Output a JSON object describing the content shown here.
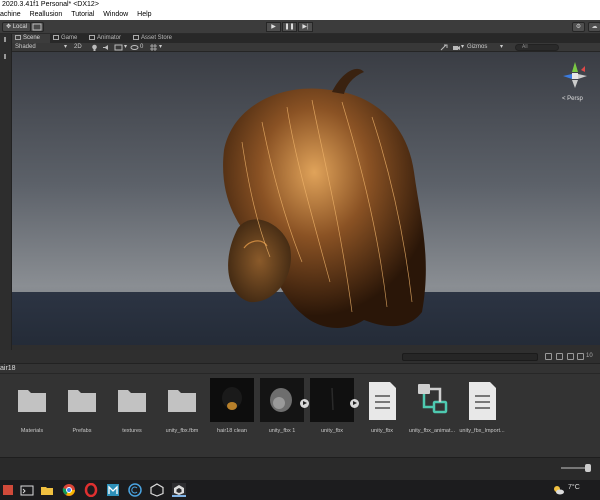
{
  "window": {
    "title": "2020.3.41f1 Personal* <DX12>"
  },
  "menu": {
    "items": [
      "achine",
      "Reallusion",
      "Tutorial",
      "Window",
      "Help"
    ]
  },
  "toolbar": {
    "pivot_label": "Local"
  },
  "tabs": [
    {
      "label": "Scene"
    },
    {
      "label": "Game"
    },
    {
      "label": "Animator"
    },
    {
      "label": "Asset Store"
    }
  ],
  "scene_toolbar": {
    "shading_mode": "Shaded",
    "view_2d": "2D",
    "gizmos_label": "Gizmos",
    "search_placeholder": "All"
  },
  "viewport": {
    "projection_label": "< Persp"
  },
  "project": {
    "breadcrumb": "air18",
    "item_count": "10",
    "assets": [
      {
        "name": "Materials",
        "type": "folder"
      },
      {
        "name": "Prefabs",
        "type": "folder"
      },
      {
        "name": "textures",
        "type": "folder"
      },
      {
        "name": "unity_fbx.fbm",
        "type": "folder"
      },
      {
        "name": "hair18 clean",
        "type": "model"
      },
      {
        "name": "unity_fbx 1",
        "type": "model"
      },
      {
        "name": "unity_fbx",
        "type": "model"
      },
      {
        "name": "unity_fbx",
        "type": "file"
      },
      {
        "name": "unity_fbx_animat...",
        "type": "animator"
      },
      {
        "name": "unity_fbx_Import...",
        "type": "file"
      }
    ]
  },
  "taskbar": {
    "temperature": "7°C"
  },
  "colors": {
    "editor_bg": "#333333",
    "titlebar_bg": "#ffffff",
    "taskbar_bg": "#1c1c1e",
    "animator_accent": "#4ec9b0"
  }
}
